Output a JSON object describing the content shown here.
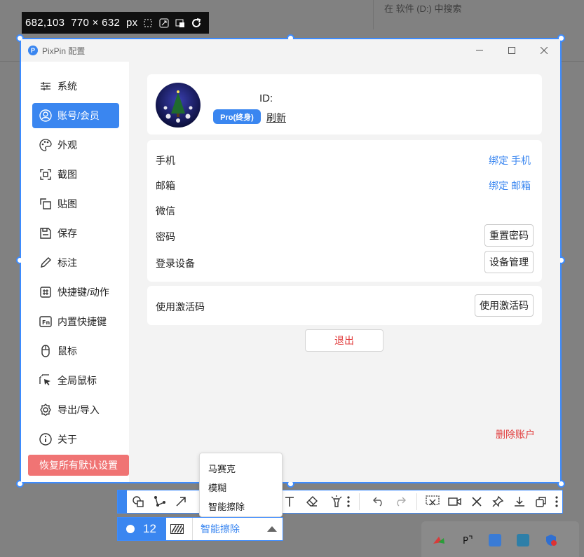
{
  "background": {
    "search_text": "在 软件 (D:) 中搜索"
  },
  "size_indicator": {
    "text": "682,103  770 × 632  px",
    "icons": [
      "crop-icon",
      "expand-icon",
      "window-capture-icon",
      "refresh-icon"
    ]
  },
  "window": {
    "title": "PixPin 配置",
    "logo_text": "P"
  },
  "sidebar": {
    "items": [
      {
        "label": "系统",
        "icon": "sliders-icon"
      },
      {
        "label": "账号/会员",
        "icon": "user-icon",
        "active": true
      },
      {
        "label": "外观",
        "icon": "palette-icon"
      },
      {
        "label": "截图",
        "icon": "screenshot-icon"
      },
      {
        "label": "贴图",
        "icon": "pin-image-icon"
      },
      {
        "label": "保存",
        "icon": "save-icon"
      },
      {
        "label": "标注",
        "icon": "pencil-icon"
      },
      {
        "label": "快捷键/动作",
        "icon": "hash-icon"
      },
      {
        "label": "内置快捷键",
        "icon": "fn-icon"
      },
      {
        "label": "鼠标",
        "icon": "mouse-icon"
      },
      {
        "label": "全局鼠标",
        "icon": "cursor-icon"
      },
      {
        "label": "导出/导入",
        "icon": "gear-icon"
      },
      {
        "label": "关于",
        "icon": "info-icon"
      }
    ],
    "reset_label": "恢复所有默认设置"
  },
  "account": {
    "id_label": "ID:",
    "badge": "Pro(终身)",
    "refresh": "刷新"
  },
  "bindings": [
    {
      "label": "手机",
      "action": "绑定 手机",
      "type": "link"
    },
    {
      "label": "邮箱",
      "action": "绑定 邮箱",
      "type": "link"
    },
    {
      "label": "微信",
      "action": "",
      "type": "none"
    },
    {
      "label": "密码",
      "action": "重置密码",
      "type": "button"
    },
    {
      "label": "登录设备",
      "action": "设备管理",
      "type": "button"
    }
  ],
  "activation": {
    "label": "使用激活码",
    "button": "使用激活码"
  },
  "logout": "退出",
  "delete_account": "删除账户",
  "dropdown": {
    "items": [
      "马赛克",
      "模糊",
      "智能擦除"
    ]
  },
  "subbar": {
    "size": "12",
    "selected": "智能擦除"
  },
  "colors": {
    "accent": "#3a86f0",
    "danger": "#e13c3c",
    "reset": "#f07474"
  }
}
